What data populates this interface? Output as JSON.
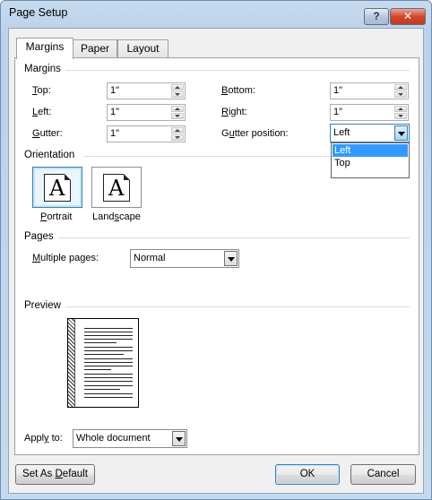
{
  "window": {
    "title": "Page Setup",
    "help_label": "?",
    "close_label": "✕"
  },
  "tabs": [
    {
      "label": "Margins",
      "active": true
    },
    {
      "label": "Paper",
      "active": false
    },
    {
      "label": "Layout",
      "active": false
    }
  ],
  "margins": {
    "section_label": "Margins",
    "top": {
      "label_pre": "",
      "label_ul": "T",
      "label_post": "op:",
      "value": "1\""
    },
    "left": {
      "label_pre": "",
      "label_ul": "L",
      "label_post": "eft:",
      "value": "1\""
    },
    "gutter": {
      "label_pre": "",
      "label_ul": "G",
      "label_post": "utter:",
      "value": "1\""
    },
    "bottom": {
      "label_pre": "",
      "label_ul": "B",
      "label_post": "ottom:",
      "value": "1\""
    },
    "right": {
      "label_pre": "",
      "label_ul": "R",
      "label_post": "ight:",
      "value": "1\""
    },
    "gutter_position": {
      "label_pre": "G",
      "label_ul": "u",
      "label_post": "tter position:",
      "value": "Left",
      "options": [
        "Left",
        "Top"
      ],
      "selected_option": "Left"
    }
  },
  "orientation": {
    "section_label": "Orientation",
    "portrait": {
      "label_pre": "",
      "label_ul": "P",
      "label_post": "ortrait",
      "glyph": "A",
      "selected": true
    },
    "landscape": {
      "label_pre": "Land",
      "label_ul": "s",
      "label_post": "cape",
      "glyph": "A",
      "selected": false
    }
  },
  "pages": {
    "section_label": "Pages",
    "multiple_pages": {
      "label_pre": "",
      "label_ul": "M",
      "label_post": "ultiple pages:",
      "value": "Normal"
    }
  },
  "preview": {
    "section_label": "Preview"
  },
  "apply_to": {
    "label_pre": "Appl",
    "label_ul": "y",
    "label_post": " to:",
    "value": "Whole document"
  },
  "buttons": {
    "set_default": {
      "label_pre": "Set As ",
      "label_ul": "D",
      "label_post": "efault"
    },
    "ok": "OK",
    "cancel": "Cancel"
  },
  "colors": {
    "selection": "#3399ff",
    "focus_border": "#3c7fb1",
    "title_gradient": "#b9d1ea"
  }
}
